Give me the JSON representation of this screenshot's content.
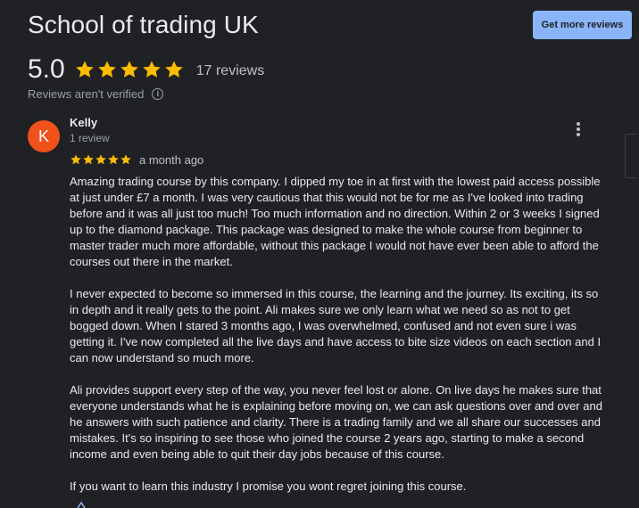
{
  "business": {
    "name": "School of trading UK",
    "get_reviews_label": "Get more reviews"
  },
  "summary": {
    "rating": "5.0",
    "stars": 5,
    "review_count": "17 reviews",
    "unverified_text": "Reviews aren't verified",
    "info_glyph": "i"
  },
  "review": {
    "avatar_letter": "K",
    "avatar_color": "#f1511b",
    "reviewer_name": "Kelly",
    "reviewer_meta": "1 review",
    "stars": 5,
    "date": "a month ago",
    "paragraphs": [
      "Amazing trading course by this company. I dipped my toe in at first with the lowest paid access possible at just under £7 a month. I was very cautious that this would not be for me as I've looked into trading before and it was all just too much! Too much information and no direction. Within 2 or 3 weeks I signed up to the diamond package. This package was designed to make the whole course from beginner to master trader much more affordable, without this package I would not have ever been able to afford the courses out there in the market.",
      "I never expected to become so immersed in this course, the learning and the journey. Its exciting, its so in depth and it really gets to the point. Ali makes sure we only learn what we need so as not to get bogged down. When I stared 3 months ago, I was overwhelmed, confused and not even sure i was getting it. I've now completed all the live days and have access to bite size videos on each section and I can now understand so much more.",
      "Ali provides support every step of the way, you never feel lost or alone. On live days he makes sure that everyone understands what he is explaining before moving on, we can ask questions over and over and he answers with such patience and clarity. There is a trading family and we all share our successes and mistakes. It's so inspiring to see those who joined the course 2 years ago, starting to make a second income and even being able to quit their day jobs because of this course.",
      "If you want to learn this industry I promise you wont regret joining this course."
    ]
  },
  "colors": {
    "background": "#202124",
    "star": "#fbbc04",
    "button": "#8ab4f8"
  }
}
